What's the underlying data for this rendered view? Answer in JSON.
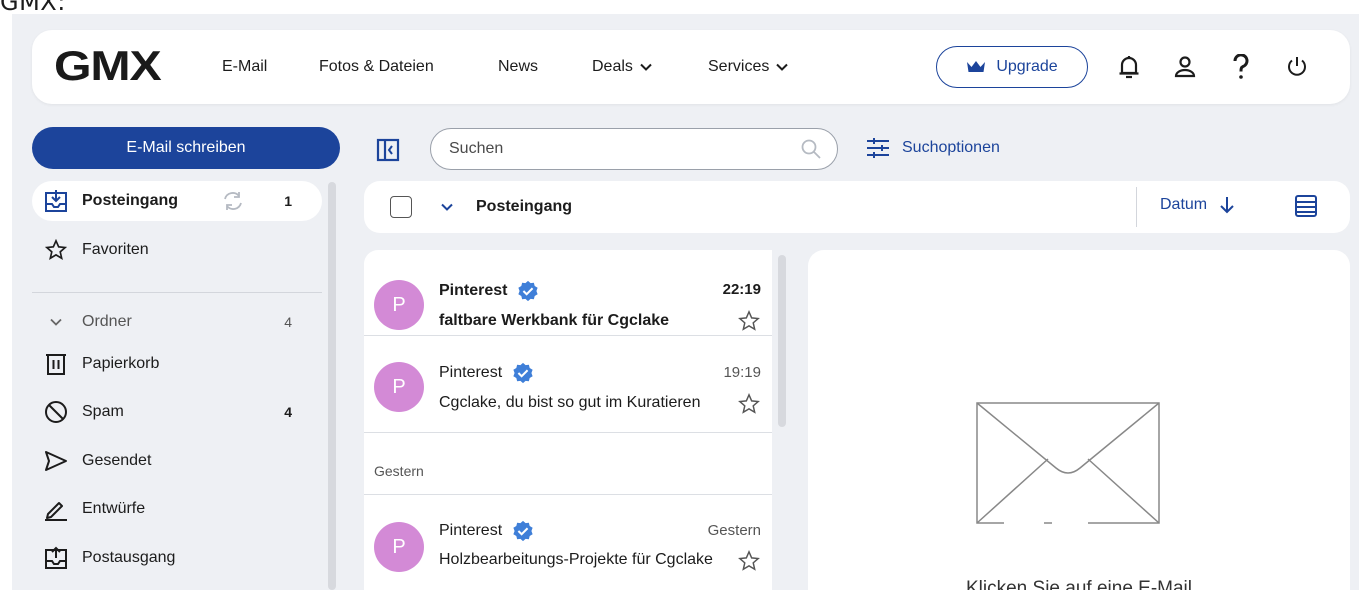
{
  "page_caption": "GMX:",
  "app": {
    "logo": "GMX",
    "nav": [
      {
        "label": "E-Mail"
      },
      {
        "label": "Fotos & Dateien"
      },
      {
        "label": "News"
      },
      {
        "label": "Deals",
        "dropdown": true
      },
      {
        "label": "Services",
        "dropdown": true
      }
    ],
    "upgrade_label": "Upgrade",
    "top_icons": [
      "bell-icon",
      "user-icon",
      "help-icon",
      "power-icon"
    ]
  },
  "sidebar": {
    "compose_label": "E-Mail schreiben",
    "items": [
      {
        "label": "Posteingang",
        "count": "1",
        "icon": "inbox-icon",
        "active": true
      },
      {
        "label": "Favoriten",
        "count": "",
        "icon": "star-icon"
      },
      {
        "label": "Ordner",
        "count": "4",
        "icon": "chevron-down-icon"
      },
      {
        "label": "Papierkorb",
        "count": "",
        "icon": "trash-icon"
      },
      {
        "label": "Spam",
        "count": "4",
        "icon": "block-icon"
      },
      {
        "label": "Gesendet",
        "count": "",
        "icon": "send-icon"
      },
      {
        "label": "Entwürfe",
        "count": "",
        "icon": "pencil-icon"
      },
      {
        "label": "Postausgang",
        "count": "",
        "icon": "outbox-icon"
      }
    ]
  },
  "search": {
    "placeholder": "Suchen",
    "options_label": "Suchoptionen"
  },
  "list_header": {
    "title": "Posteingang",
    "sort_label": "Datum"
  },
  "mails": [
    {
      "avatar": "P",
      "sender": "Pinterest",
      "time": "22:19",
      "subject": "faltbare Werkbank für Cgclake",
      "unread": true
    },
    {
      "avatar": "P",
      "sender": "Pinterest",
      "time": "19:19",
      "subject": "Cgclake, du bist so gut im Kuratieren",
      "unread": false
    },
    {
      "avatar": "P",
      "sender": "Pinterest",
      "time": "Gestern",
      "subject": "Holzbearbeitungs-Projekte für Cgclake",
      "unread": false
    }
  ],
  "date_group": "Gestern",
  "preview": {
    "text": "Klicken Sie auf eine E-Mail"
  },
  "colors": {
    "brand_blue": "#1c449b",
    "verified_blue": "#3f7fd8",
    "avatar_pink": "#d38ad6",
    "background": "#eef0f4"
  }
}
